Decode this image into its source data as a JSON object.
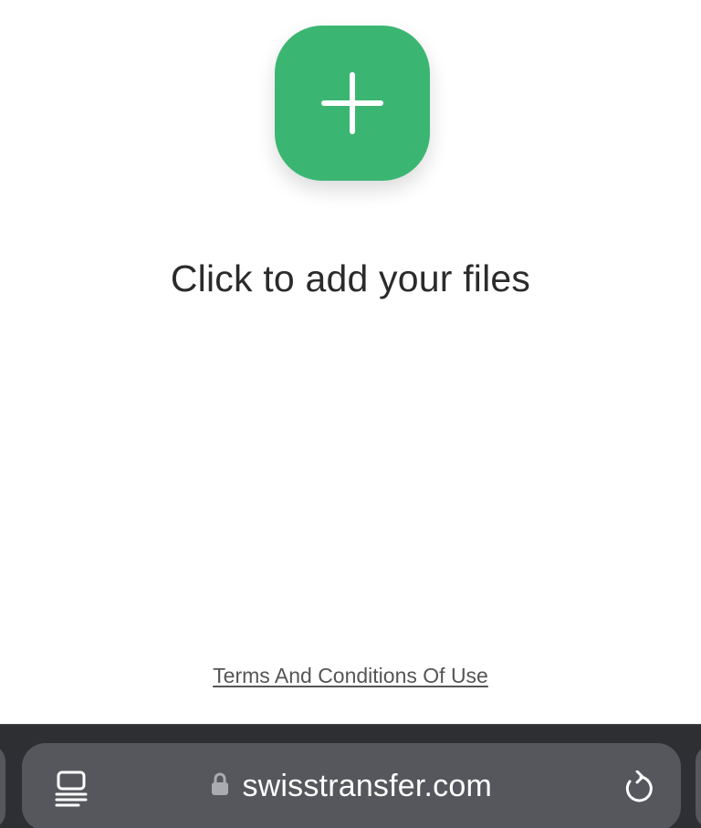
{
  "main": {
    "add_button_icon": "plus-icon",
    "headline": "Click to add your files",
    "terms_link": "Terms And Conditions Of Use"
  },
  "browser": {
    "url": "swisstransfer.com",
    "icons": {
      "tabs": "tab-overview-icon",
      "lock": "lock-icon",
      "reload": "reload-icon"
    }
  },
  "colors": {
    "accent_green": "#3bb672",
    "headline_text": "#2b2b2b",
    "toolbar_bg": "#2e2f33",
    "address_bar_bg": "#55575c"
  }
}
